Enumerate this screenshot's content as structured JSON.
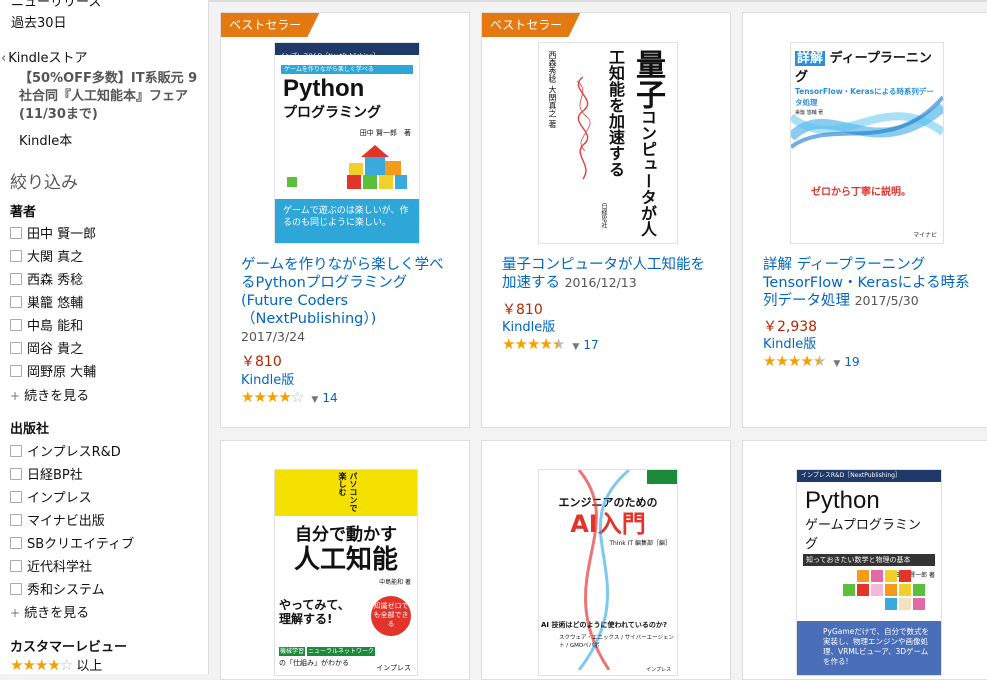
{
  "sidebar": {
    "cut_text": "ニューリリース",
    "days": "過去30日",
    "back_chevron": "‹",
    "back_label": "Kindleストア",
    "promo": "【50%OFF多数】IT系販元 9社合同『人工知能本』フェア(11/30まで)",
    "kindle_book": "Kindle本",
    "refine": "絞り込み",
    "author_title": "著者",
    "authors": [
      "田中 賢一郎",
      "大関 真之",
      "西森 秀稔",
      "巣籠 悠輔",
      "中島 能和",
      "岡谷 貴之",
      "岡野原 大輔"
    ],
    "see_more": "続きを見る",
    "publisher_title": "出版社",
    "publishers": [
      "インプレスR&D",
      "日経BP社",
      "インプレス",
      "マイナビ出版",
      "SBクリエイティブ",
      "近代科学社",
      "秀和システム"
    ],
    "review_title": "カスタマーレビュー",
    "review_stars": 4,
    "review_suffix": "以上"
  },
  "products": [
    {
      "badge": "ベストセラー",
      "title": "ゲームを作りながら楽しく学べるPythonプログラミング (Future Coders（NextPublishing）)",
      "date": "2017/3/24",
      "price": "￥810",
      "format": "Kindle版",
      "rating": 4.0,
      "reviews": "14",
      "cover": {
        "series": "インプレスR&D［NextPublishing］",
        "top_line": "ゲームを作りながら楽しく学べる",
        "main1": "Python",
        "main2": "プログラミング",
        "author": "田中 賢一郎　著",
        "band": "ゲームで遊ぶのは楽しいが、作るのも同じように楽しい。",
        "bg": "#ffffff",
        "band_color": "#2ea6d8"
      }
    },
    {
      "badge": "ベストセラー",
      "title": "量子コンピュータが人工知能を加速する",
      "date": "2016/12/13",
      "price": "￥810",
      "format": "Kindle版",
      "rating": 4.5,
      "reviews": "17",
      "cover": {
        "title_big": "量子",
        "title_rest": "コンピュータが人工知能を加速する",
        "authors": "西森秀稔 大関真之 著",
        "publisher": "日経BP社"
      }
    },
    {
      "badge": "",
      "title": "詳解 ディープラーニング TensorFlow・Kerasによる時系列データ処理",
      "date": "2017/5/30",
      "price": "￥2,938",
      "format": "Kindle版",
      "rating": 4.5,
      "reviews": "19",
      "cover": {
        "tag": "詳解",
        "main": "ディープラーニング",
        "sub": "TensorFlow・Kerasによる時系列データ処理",
        "author": "巣籠 悠輔 著",
        "catch": "ゼロから丁寧に説明。",
        "publisher": "マイナビ"
      }
    },
    {
      "badge": "",
      "cover": {
        "side": "パソコンで楽しむ",
        "main1": "自分で動かす",
        "main2": "人工知能",
        "tagline1": "やってみて、",
        "tagline2": "理解する!",
        "seal": "知識ゼロでも全部できる",
        "author": "中島能和 著",
        "publisher": "インプレス",
        "tag1": "機械学習",
        "tag2": "ニューラルネットワーク",
        "tag3": "の「仕組み」がわかる"
      }
    },
    {
      "badge": "",
      "cover": {
        "small": "エンジニアのための",
        "main": "AI入門",
        "editor": "Think IT 編集部［編］",
        "question": "AI 技術はどのように使われているのか?",
        "cases": "スクウェア・エニックス / サイバーエージェント / GMOペパボ",
        "publisher": "インプレス"
      }
    },
    {
      "badge": "",
      "cover": {
        "series": "インプレスR&D［NextPublishing］",
        "main1": "Python",
        "main2": "ゲームプログラミング",
        "strip": "知っておきたい数学と物理の基本",
        "author": "田中 賢一郎 著",
        "band": "PyGameだけで、自分で数式を実装し、物理エンジンや画像処理、VRMLビューア、3Dゲームを作る!"
      }
    }
  ]
}
